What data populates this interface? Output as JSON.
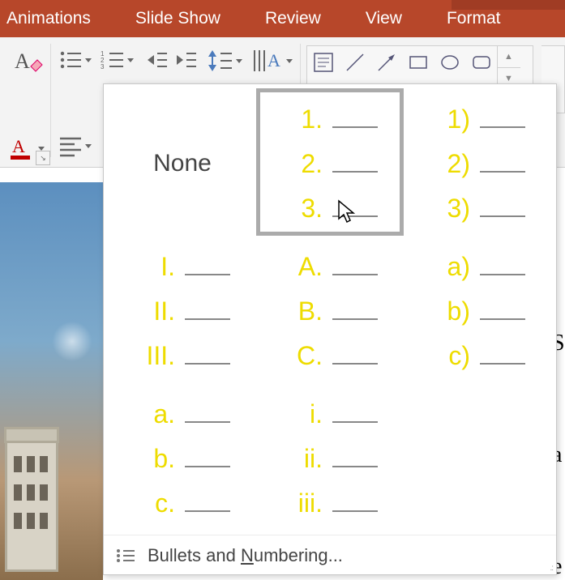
{
  "tabs": {
    "animations": "Animations",
    "slideshow": "Slide Show",
    "review": "Review",
    "view": "View",
    "format": "Format"
  },
  "numbering_panel": {
    "none_label": "None",
    "options": [
      {
        "id": "none",
        "lines": []
      },
      {
        "id": "num-period",
        "lines": [
          "1.",
          "2.",
          "3."
        ]
      },
      {
        "id": "num-paren",
        "lines": [
          "1)",
          "2)",
          "3)"
        ]
      },
      {
        "id": "upper-roman",
        "lines": [
          "I.",
          "II.",
          "III."
        ]
      },
      {
        "id": "upper-alpha",
        "lines": [
          "A.",
          "B.",
          "C."
        ]
      },
      {
        "id": "lower-alpha-paren",
        "lines": [
          "a)",
          "b)",
          "c)"
        ]
      },
      {
        "id": "lower-alpha-period",
        "lines": [
          "a.",
          "b.",
          "c."
        ]
      },
      {
        "id": "lower-roman",
        "lines": [
          "i.",
          "ii.",
          "iii."
        ]
      },
      {
        "id": "blank",
        "lines": []
      }
    ],
    "selected": "num-period",
    "footer_prefix": "Bullets and ",
    "footer_ul": "N",
    "footer_suffix": "umbering..."
  },
  "right_sliver": {
    "a": "S",
    "b": "a",
    "c": "e"
  }
}
